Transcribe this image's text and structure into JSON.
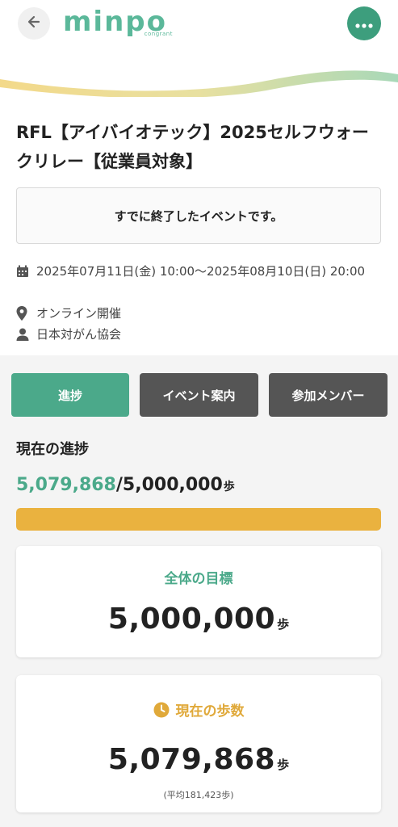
{
  "header": {
    "logo_text": "minpo",
    "logo_sub": "congrant"
  },
  "event": {
    "title": "RFL【アイバイオテック】2025セルフウォークリレー【従業員対象】",
    "ended_notice": "すでに終了したイベントです。",
    "date": "2025年07月11日(金) 10:00〜2025年08月10日(日) 20:00",
    "place": "オンライン開催",
    "organizer": "日本対がん協会"
  },
  "tabs": {
    "progress": "進捗",
    "guide": "イベント案内",
    "members": "参加メンバー"
  },
  "progress": {
    "label": "現在の進捗",
    "current": "5,079,868",
    "total": "/5,000,000",
    "unit": "歩",
    "fill_fraction": 1.0
  },
  "goal_card": {
    "title": "全体の目標",
    "value": "5,000,000",
    "unit": "歩"
  },
  "now_card": {
    "title": "現在の歩数",
    "value": "5,079,868",
    "unit": "歩",
    "average": "(平均181,423歩)"
  },
  "colors": {
    "brand_green": "#4ba98a",
    "accent_yellow": "#eab23f",
    "tab_inactive": "#555555"
  },
  "icons": {
    "back": "arrow-left-icon",
    "more": "more-dots-icon",
    "calendar": "calendar-icon",
    "location": "location-pin-icon",
    "organizer": "person-icon",
    "clock": "clock-icon"
  }
}
